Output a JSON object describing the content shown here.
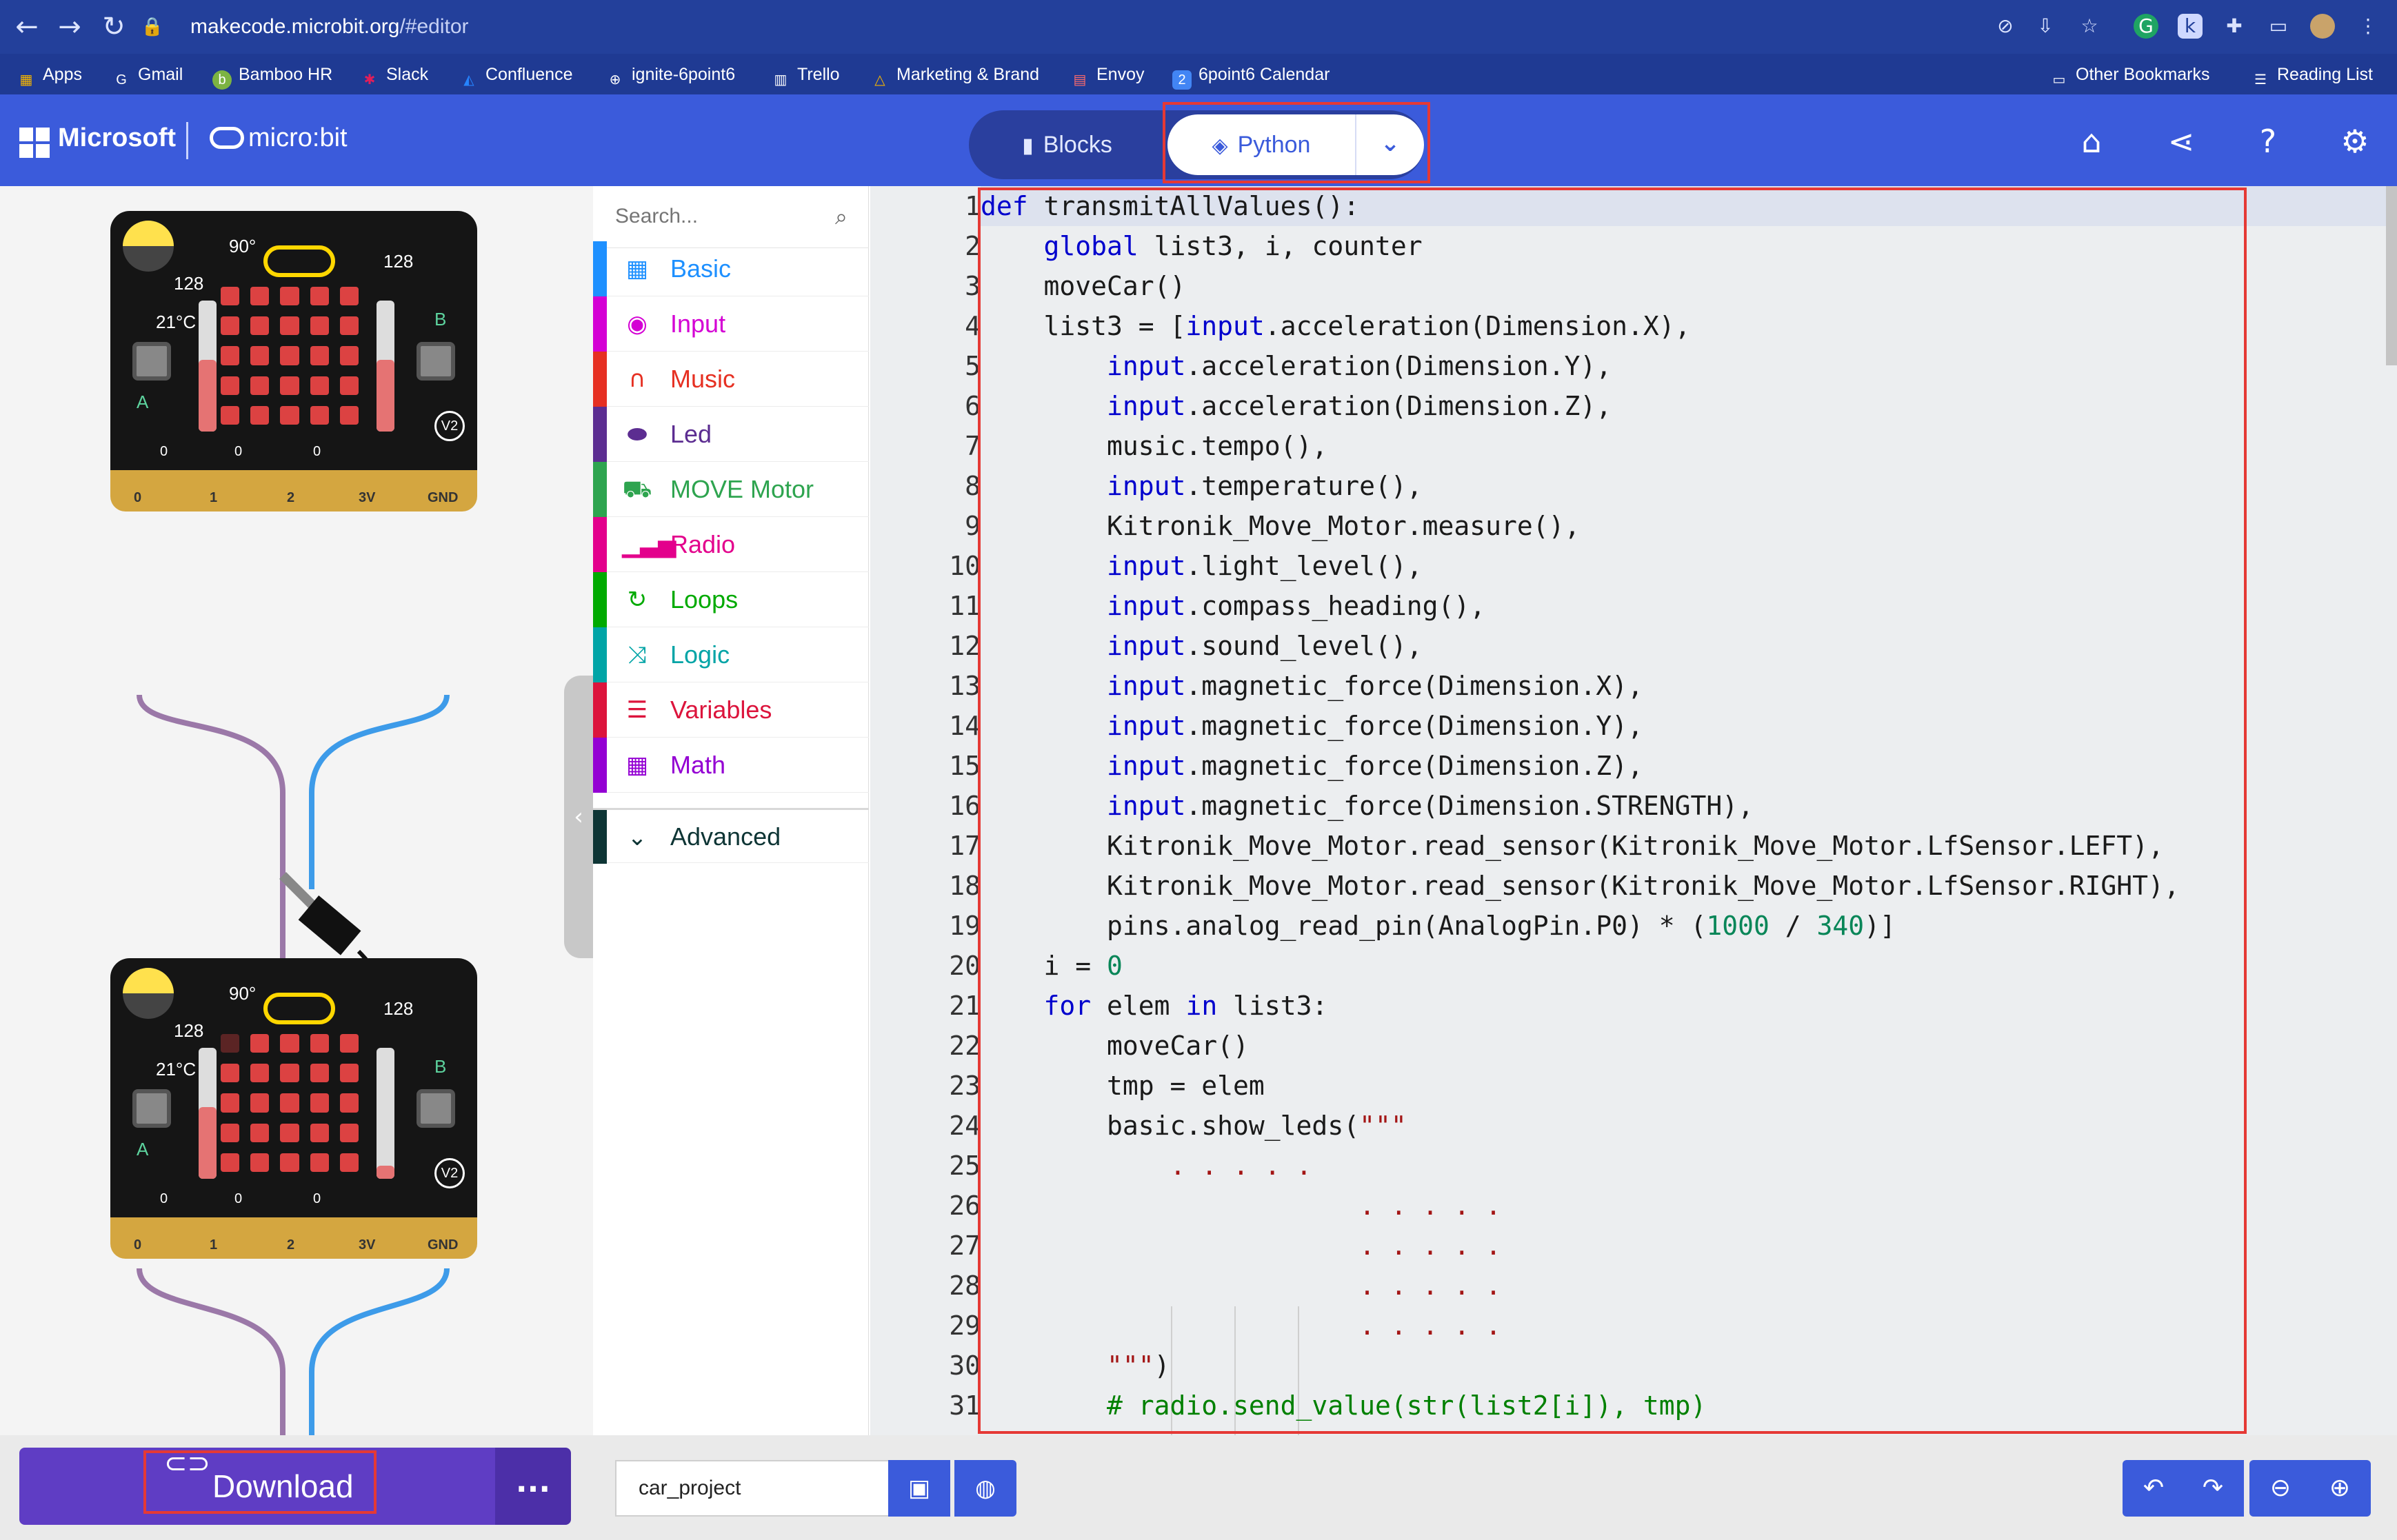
{
  "browser": {
    "url_host": "makecode.microbit.org",
    "url_path": "/#editor",
    "bookmarks": [
      "Apps",
      "Gmail",
      "Bamboo HR",
      "Slack",
      "Confluence",
      "ignite-6point6",
      "Trello",
      "Marketing & Brand",
      "Envoy",
      "6point6 Calendar"
    ],
    "other_bookmarks": "Other Bookmarks",
    "reading_list": "Reading List"
  },
  "header": {
    "brand": "Microsoft",
    "product": "micro:bit",
    "tabs": {
      "blocks": "Blocks",
      "python": "Python"
    },
    "active_tab": "Python"
  },
  "simulator": {
    "board_labels": {
      "light": "128",
      "compass": "90°",
      "sound": "128",
      "temp": "21°C",
      "button_a": "A",
      "button_b": "B",
      "version": "V2",
      "pins": [
        "0",
        "1",
        "2",
        "3V",
        "GND"
      ],
      "pin_values": [
        "0",
        "0",
        "0"
      ]
    }
  },
  "toolbox": {
    "search_placeholder": "Search...",
    "categories": [
      {
        "label": "Basic",
        "color": "#1e90ff",
        "icon": "grid-icon"
      },
      {
        "label": "Input",
        "color": "#d400d4",
        "icon": "target-icon"
      },
      {
        "label": "Music",
        "color": "#e63022",
        "icon": "headphones-icon"
      },
      {
        "label": "Led",
        "color": "#5c2d91",
        "icon": "toggle-icon"
      },
      {
        "label": "MOVE Motor",
        "color": "#2ea44f",
        "icon": "car-icon"
      },
      {
        "label": "Radio",
        "color": "#e3008c",
        "icon": "signal-icon"
      },
      {
        "label": "Loops",
        "color": "#00aa00",
        "icon": "refresh-icon"
      },
      {
        "label": "Logic",
        "color": "#00a4a6",
        "icon": "shuffle-icon"
      },
      {
        "label": "Variables",
        "color": "#dc143c",
        "icon": "list-icon"
      },
      {
        "label": "Math",
        "color": "#9400d3",
        "icon": "calculator-icon"
      }
    ],
    "advanced": "Advanced"
  },
  "editor": {
    "line_numbers": [
      "1",
      "2",
      "3",
      "4",
      "5",
      "6",
      "7",
      "8",
      "9",
      "10",
      "11",
      "12",
      "13",
      "14",
      "15",
      "16",
      "17",
      "18",
      "19",
      "20",
      "21",
      "22",
      "23",
      "24",
      "25",
      "26",
      "27",
      "28",
      "29",
      "30",
      "31"
    ],
    "lines": [
      [
        [
          "kw",
          "def"
        ],
        [
          "t",
          " transmitAllValues():"
        ]
      ],
      [
        [
          "t",
          "    "
        ],
        [
          "kw",
          "global"
        ],
        [
          "t",
          " list3, i, counter"
        ]
      ],
      [
        [
          "t",
          "    moveCar()"
        ]
      ],
      [
        [
          "t",
          "    list3 = ["
        ],
        [
          "kw",
          "input"
        ],
        [
          "t",
          ".acceleration(Dimension.X),"
        ]
      ],
      [
        [
          "t",
          "        "
        ],
        [
          "kw",
          "input"
        ],
        [
          "t",
          ".acceleration(Dimension.Y),"
        ]
      ],
      [
        [
          "t",
          "        "
        ],
        [
          "kw",
          "input"
        ],
        [
          "t",
          ".acceleration(Dimension.Z),"
        ]
      ],
      [
        [
          "t",
          "        music.tempo(),"
        ]
      ],
      [
        [
          "t",
          "        "
        ],
        [
          "kw",
          "input"
        ],
        [
          "t",
          ".temperature(),"
        ]
      ],
      [
        [
          "t",
          "        Kitronik_Move_Motor.measure(),"
        ]
      ],
      [
        [
          "t",
          "        "
        ],
        [
          "kw",
          "input"
        ],
        [
          "t",
          ".light_level(),"
        ]
      ],
      [
        [
          "t",
          "        "
        ],
        [
          "kw",
          "input"
        ],
        [
          "t",
          ".compass_heading(),"
        ]
      ],
      [
        [
          "t",
          "        "
        ],
        [
          "kw",
          "input"
        ],
        [
          "t",
          ".sound_level(),"
        ]
      ],
      [
        [
          "t",
          "        "
        ],
        [
          "kw",
          "input"
        ],
        [
          "t",
          ".magnetic_force(Dimension.X),"
        ]
      ],
      [
        [
          "t",
          "        "
        ],
        [
          "kw",
          "input"
        ],
        [
          "t",
          ".magnetic_force(Dimension.Y),"
        ]
      ],
      [
        [
          "t",
          "        "
        ],
        [
          "kw",
          "input"
        ],
        [
          "t",
          ".magnetic_force(Dimension.Z),"
        ]
      ],
      [
        [
          "t",
          "        "
        ],
        [
          "kw",
          "input"
        ],
        [
          "t",
          ".magnetic_force(Dimension.STRENGTH),"
        ]
      ],
      [
        [
          "t",
          "        Kitronik_Move_Motor.read_sensor(Kitronik_Move_Motor.LfSensor.LEFT),"
        ]
      ],
      [
        [
          "t",
          "        Kitronik_Move_Motor.read_sensor(Kitronik_Move_Motor.LfSensor.RIGHT),"
        ]
      ],
      [
        [
          "t",
          "        pins.analog_read_pin(AnalogPin.P0) * ("
        ],
        [
          "num",
          "1000"
        ],
        [
          "t",
          " / "
        ],
        [
          "num",
          "340"
        ],
        [
          "t",
          ")]"
        ]
      ],
      [
        [
          "t",
          "    i = "
        ],
        [
          "num",
          "0"
        ]
      ],
      [
        [
          "t",
          "    "
        ],
        [
          "kw",
          "for"
        ],
        [
          "t",
          " elem "
        ],
        [
          "kw",
          "in"
        ],
        [
          "t",
          " list3:"
        ]
      ],
      [
        [
          "t",
          "        moveCar()"
        ]
      ],
      [
        [
          "t",
          "        tmp = elem"
        ]
      ],
      [
        [
          "t",
          "        basic.show_leds("
        ],
        [
          "str",
          "\"\"\""
        ]
      ],
      [
        [
          "str",
          "            . . . . ."
        ]
      ],
      [
        [
          "str",
          "                        . . . . ."
        ]
      ],
      [
        [
          "str",
          "                        . . . . ."
        ]
      ],
      [
        [
          "str",
          "                        . . . . ."
        ]
      ],
      [
        [
          "str",
          "                        . . . . ."
        ]
      ],
      [
        [
          "str",
          "        \"\"\""
        ],
        [
          "t",
          ")"
        ]
      ],
      [
        [
          "cmt",
          "        # radio.send_value(str(list2[i]), tmp)"
        ]
      ]
    ]
  },
  "footer": {
    "download_label": "Download",
    "more_label": "...",
    "project_name": "car_project"
  }
}
